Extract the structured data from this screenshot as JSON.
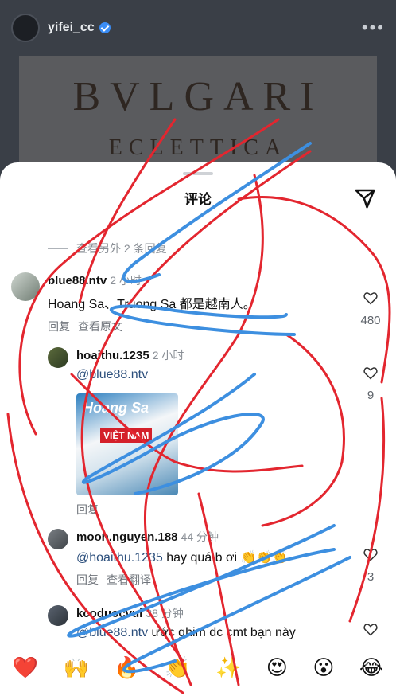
{
  "post": {
    "username": "yifei_cc",
    "ad_brand": "BVLGARI",
    "ad_subtitle": "ECLETTICA"
  },
  "sheet": {
    "title": "评论",
    "view_more_replies": "查看另外 2 条回复"
  },
  "comments": [
    {
      "username": "blue88.ntv",
      "time": "2 小时",
      "text": "Hoang Sa、Truong Sa 都是越南人。",
      "reply_label": "回复",
      "translate_label": "查看原文",
      "likes": "480"
    },
    {
      "username": "hoaithu.1235",
      "time": "2 小时",
      "mention": "@blue88.ntv",
      "sticker_title": "Hoang Sa",
      "sticker_sub": "VIỆT NAM",
      "reply_label": "回复",
      "likes": "9"
    },
    {
      "username": "moon.nguyen.188",
      "time": "44 分钟",
      "mention": "@hoaithu.1235",
      "text": " hay quá b ơi 👏👏👏",
      "reply_label": "回复",
      "translate_label": "查看翻译",
      "likes": "3"
    },
    {
      "username": "kcoduocvui",
      "time": "38 分钟",
      "mention": "@blue88.ntv",
      "text": " ước ghim dc cmt bạn này"
    }
  ],
  "emoji_bar": [
    "❤️",
    "🙌",
    "🔥",
    "👏",
    "✨",
    "😍",
    "😮",
    "😂"
  ],
  "colors": {
    "red_scribble": "#e3262f",
    "blue_scribble": "#3d8fe0"
  }
}
